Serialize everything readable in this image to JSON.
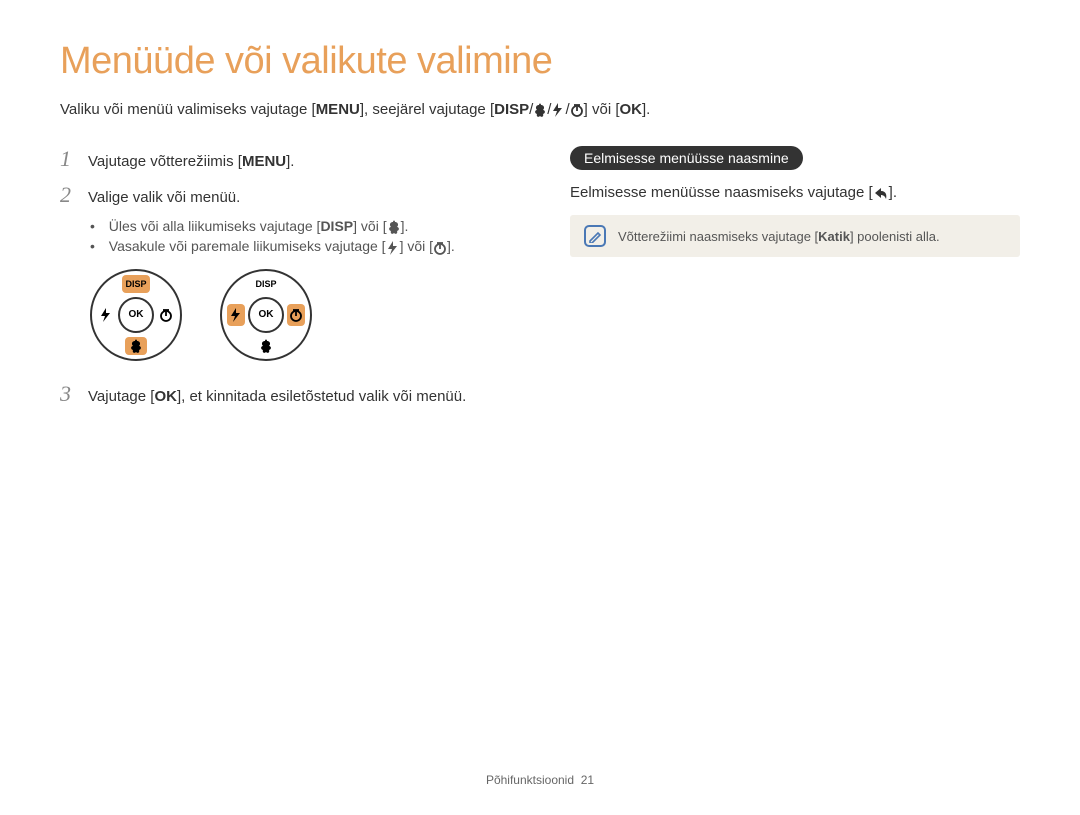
{
  "title": "Menüüde või valikute valimine",
  "intro": {
    "pre": "Valiku või menüü valimiseks vajutage [",
    "menu": "MENU",
    "mid1": "], seejärel vajutage [",
    "disp": "DISP",
    "sep1": "/",
    "sep2": "/",
    "sep3": "/",
    "mid2": "] või [",
    "ok": "OK",
    "post": "]."
  },
  "steps": {
    "s1": {
      "num": "1",
      "pre": "Vajutage võtterežiimis [",
      "menu": "MENU",
      "post": "]."
    },
    "s2": {
      "num": "2",
      "text": "Valige valik või menüü."
    },
    "s3": {
      "num": "3",
      "pre": "Vajutage [",
      "ok": "OK",
      "post": "], et kinnitada esiletõstetud valik või menüü."
    }
  },
  "bullets": {
    "b1": {
      "pre": "Üles või alla liikumiseks vajutage [",
      "disp": "DISP",
      "mid": "] või [",
      "post": "]."
    },
    "b2": {
      "pre": "Vasakule või paremale liikumiseks vajutage [",
      "mid": "] või [",
      "post": "]."
    }
  },
  "dial": {
    "disp": "DISP",
    "ok": "OK"
  },
  "right": {
    "pill": "Eelmisesse menüüsse naasmine",
    "text_pre": "Eelmisesse menüüsse naasmiseks vajutage [",
    "text_post": "]."
  },
  "note": {
    "pre": "Võtterežiimi naasmiseks vajutage [",
    "key": "Katik",
    "post": "] poolenisti alla."
  },
  "footer": {
    "label": "Põhifunktsioonid",
    "page": "21"
  }
}
